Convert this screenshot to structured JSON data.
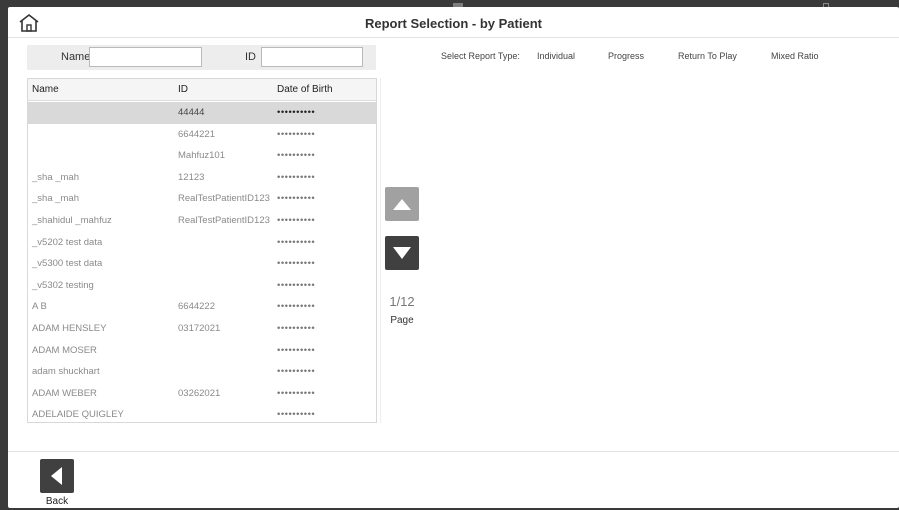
{
  "header": {
    "title": "Report Selection - by Patient",
    "home_icon": "home-icon"
  },
  "search": {
    "name_label": "Name",
    "name_value": "",
    "id_label": "ID",
    "id_value": ""
  },
  "report_types": {
    "label": "Select Report Type:",
    "options": [
      "Individual",
      "Progress",
      "Return To Play",
      "Mixed Ratio"
    ]
  },
  "table": {
    "headers": [
      "Name",
      "ID",
      "Date of Birth"
    ],
    "rows": [
      {
        "name": "",
        "id": "44444",
        "dob": "••••••••••",
        "selected": true
      },
      {
        "name": "",
        "id": "6644221",
        "dob": "••••••••••"
      },
      {
        "name": "",
        "id": "Mahfuz101",
        "dob": "••••••••••"
      },
      {
        "name": "_sha _mah",
        "id": "12123",
        "dob": "••••••••••"
      },
      {
        "name": "_sha _mah",
        "id": "RealTestPatientID123",
        "dob": "••••••••••"
      },
      {
        "name": "_shahidul _mahfuz",
        "id": "RealTestPatientID123",
        "dob": "••••••••••"
      },
      {
        "name": "_v5202 test data",
        "id": "",
        "dob": "••••••••••"
      },
      {
        "name": "_v5300 test data",
        "id": "",
        "dob": "••••••••••"
      },
      {
        "name": "_v5302 testing",
        "id": "",
        "dob": "••••••••••"
      },
      {
        "name": "A B",
        "id": "6644222",
        "dob": "••••••••••"
      },
      {
        "name": "ADAM HENSLEY",
        "id": "03172021",
        "dob": "••••••••••"
      },
      {
        "name": "ADAM MOSER",
        "id": "",
        "dob": "••••••••••"
      },
      {
        "name": "adam shuckhart",
        "id": "",
        "dob": "••••••••••"
      },
      {
        "name": "ADAM WEBER",
        "id": "03262021",
        "dob": "••••••••••"
      },
      {
        "name": "ADELAIDE QUIGLEY",
        "id": "",
        "dob": "••••••••••"
      }
    ]
  },
  "pagination": {
    "current": "1/12",
    "label": "Page",
    "up_icon": "triangle-up-icon",
    "down_icon": "triangle-down-icon"
  },
  "footer": {
    "back_label": "Back",
    "back_icon": "triangle-left-icon"
  },
  "colors": {
    "selected_row": "#d9d9d9",
    "button_dark": "#404040",
    "button_disabled": "#a1a1a1"
  }
}
